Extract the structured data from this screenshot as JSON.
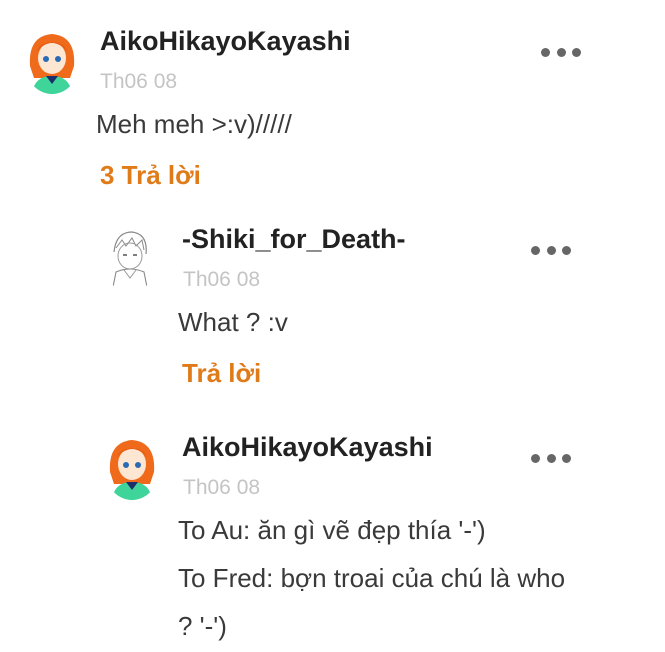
{
  "comments": [
    {
      "author": "AikoHikayoKayashi",
      "date": "Th06 08",
      "lines": [
        "Meh meh >:v)/////"
      ],
      "reply_label": "3 Trả lời",
      "avatar_icon": "orange-haired-anime-girl-avatar",
      "more_icon": "more-dots-icon"
    },
    {
      "author": "-Shiki_for_Death-",
      "date": "Th06 08",
      "lines": [
        "What ? :v"
      ],
      "reply_label": "Trả lời",
      "avatar_icon": "sketch-anime-boy-avatar",
      "more_icon": "more-dots-icon"
    },
    {
      "author": "AikoHikayoKayashi",
      "date": "Th06 08",
      "lines": [
        "To Au: ăn gì vẽ đẹp thía '-')",
        "To Fred: bợn troai của chú là who",
        "? '-')"
      ],
      "avatar_icon": "orange-haired-anime-girl-avatar",
      "more_icon": "more-dots-icon"
    }
  ],
  "colors": {
    "reply_accent": "#e07b1a",
    "date_gray": "#c4c4c4",
    "author_text": "#222222"
  }
}
